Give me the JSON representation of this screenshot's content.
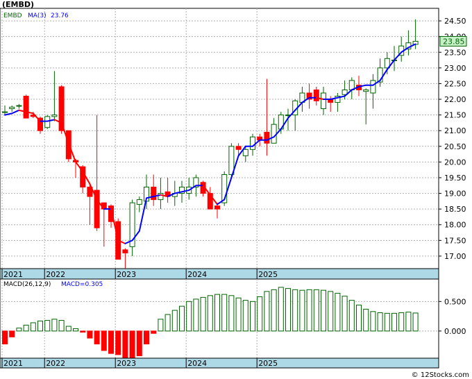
{
  "header": {
    "title": "(EMBD)",
    "watermark": "© 12Stocks.com"
  },
  "colors": {
    "up": "#006400",
    "down": "#ff0000",
    "ma": "#0000ff",
    "ma_down": "#ff0000",
    "axis_band": "#add8e6",
    "grid": "#b0b0b0",
    "last_price_box": "#c8f0c8"
  },
  "chart_data": [
    {
      "type": "candlestick",
      "title": "",
      "legend": {
        "symbol": "EMBD",
        "ma_label": "MA(3)",
        "ma_value": "23.76"
      },
      "last_price_label": "23.85",
      "y_ticks": [
        "17.00",
        "17.50",
        "18.00",
        "18.50",
        "19.00",
        "19.50",
        "20.00",
        "20.50",
        "21.00",
        "21.50",
        "22.00",
        "22.50",
        "23.00",
        "23.50",
        "24.00",
        "24.50"
      ],
      "ylim": [
        16.6,
        24.9
      ],
      "x_year_labels": [
        {
          "label": "2021",
          "index": 0
        },
        {
          "label": "2022",
          "index": 6
        },
        {
          "label": "2023",
          "index": 16
        },
        {
          "label": "2024",
          "index": 26
        },
        {
          "label": "2025",
          "index": 36
        }
      ],
      "ohlc": [
        [
          21.6,
          21.8,
          21.5,
          21.6
        ],
        [
          21.7,
          21.8,
          21.6,
          21.75
        ],
        [
          21.8,
          21.85,
          21.7,
          21.8
        ],
        [
          22.1,
          22.15,
          21.4,
          21.4
        ],
        [
          21.5,
          21.6,
          21.4,
          21.45
        ],
        [
          21.4,
          21.45,
          20.9,
          21.0
        ],
        [
          21.1,
          21.5,
          21.05,
          21.45
        ],
        [
          21.45,
          22.9,
          21.3,
          21.5
        ],
        [
          22.4,
          22.45,
          20.9,
          21.0
        ],
        [
          21.0,
          21.0,
          20.0,
          20.1
        ],
        [
          20.05,
          20.1,
          19.5,
          20.0
        ],
        [
          19.85,
          19.9,
          19.0,
          19.2
        ],
        [
          19.2,
          19.3,
          18.0,
          18.9
        ],
        [
          19.1,
          21.5,
          17.8,
          17.9
        ],
        [
          18.7,
          18.7,
          17.3,
          18.5
        ],
        [
          18.6,
          18.65,
          17.9,
          18.1
        ],
        [
          18.1,
          18.2,
          16.9,
          16.9
        ],
        [
          17.2,
          17.25,
          16.6,
          17.1
        ],
        [
          17.3,
          18.8,
          17.0,
          18.7
        ],
        [
          18.65,
          18.9,
          18.4,
          18.8
        ],
        [
          18.75,
          19.6,
          18.5,
          19.2
        ],
        [
          19.2,
          19.6,
          18.6,
          18.8
        ],
        [
          18.8,
          19.5,
          18.5,
          19.0
        ],
        [
          19.05,
          19.5,
          18.7,
          18.9
        ],
        [
          18.9,
          19.4,
          18.6,
          19.0
        ],
        [
          19.0,
          19.4,
          18.7,
          19.2
        ],
        [
          19.0,
          19.5,
          18.8,
          19.2
        ],
        [
          19.2,
          19.6,
          18.9,
          19.5
        ],
        [
          19.35,
          19.4,
          18.9,
          19.0
        ],
        [
          19.0,
          19.2,
          18.5,
          18.5
        ],
        [
          18.6,
          18.7,
          18.2,
          18.5
        ],
        [
          18.7,
          19.7,
          18.6,
          19.6
        ],
        [
          19.6,
          20.6,
          19.5,
          20.5
        ],
        [
          20.5,
          20.6,
          20.2,
          20.4
        ],
        [
          20.2,
          20.5,
          20.0,
          20.4
        ],
        [
          20.4,
          20.9,
          20.2,
          20.8
        ],
        [
          20.8,
          20.9,
          20.5,
          20.7
        ],
        [
          20.95,
          22.65,
          20.2,
          20.6
        ],
        [
          20.6,
          21.4,
          20.6,
          21.2
        ],
        [
          21.05,
          21.6,
          20.9,
          21.5
        ],
        [
          21.5,
          21.7,
          21.0,
          21.5
        ],
        [
          21.5,
          22.0,
          21.0,
          21.95
        ],
        [
          21.9,
          22.4,
          21.6,
          22.2
        ],
        [
          22.2,
          22.5,
          21.7,
          22.0
        ],
        [
          22.3,
          22.4,
          21.8,
          21.95
        ],
        [
          21.7,
          22.4,
          21.5,
          22.2
        ],
        [
          22.0,
          22.1,
          21.6,
          21.9
        ],
        [
          21.9,
          22.2,
          21.6,
          22.1
        ],
        [
          22.15,
          22.6,
          22.0,
          22.3
        ],
        [
          22.3,
          22.7,
          22.0,
          22.6
        ],
        [
          22.45,
          22.75,
          22.1,
          22.3
        ],
        [
          22.25,
          22.35,
          21.2,
          22.3
        ],
        [
          22.2,
          22.8,
          21.7,
          22.6
        ],
        [
          22.55,
          23.3,
          22.4,
          23.0
        ],
        [
          23.0,
          23.5,
          22.8,
          23.3
        ],
        [
          23.25,
          23.7,
          22.9,
          23.25
        ],
        [
          23.4,
          24.0,
          23.2,
          23.7
        ],
        [
          23.6,
          24.2,
          23.4,
          23.8
        ],
        [
          23.75,
          24.55,
          23.6,
          23.85
        ]
      ],
      "ma3": [
        21.5,
        21.55,
        21.65,
        21.6,
        21.55,
        21.3,
        21.3,
        21.35,
        21.25,
        20.6,
        20.0,
        19.7,
        19.3,
        18.8,
        18.5,
        18.5,
        17.5,
        17.4,
        17.5,
        17.8,
        18.85,
        18.9,
        18.95,
        18.9,
        19.0,
        19.05,
        19.1,
        19.25,
        19.25,
        18.95,
        18.65,
        18.8,
        19.5,
        20.2,
        20.5,
        20.5,
        20.7,
        20.7,
        20.8,
        21.05,
        21.4,
        21.65,
        21.9,
        22.05,
        22.05,
        22.0,
        22.0,
        22.05,
        22.1,
        22.3,
        22.4,
        22.45,
        22.45,
        22.6,
        22.95,
        23.25,
        23.5,
        23.65,
        23.76
      ]
    },
    {
      "type": "bar",
      "title": "",
      "legend": {
        "params": "MACD(26,12,9)",
        "value_label": "MACD=0.305"
      },
      "y_ticks": [
        "0.500",
        "0.000"
      ],
      "ylim": [
        -0.46,
        0.88
      ],
      "x_year_labels": [
        {
          "label": "2021",
          "index": 0
        },
        {
          "label": "2022",
          "index": 6
        },
        {
          "label": "2023",
          "index": 16
        },
        {
          "label": "2024",
          "index": 26
        },
        {
          "label": "2025",
          "index": 36
        }
      ],
      "values": [
        -0.22,
        -0.1,
        0.05,
        0.1,
        0.14,
        0.17,
        0.18,
        0.2,
        0.18,
        0.08,
        0.04,
        -0.02,
        -0.12,
        -0.22,
        -0.33,
        -0.38,
        -0.4,
        -0.45,
        -0.45,
        -0.42,
        -0.22,
        -0.04,
        0.2,
        0.28,
        0.35,
        0.42,
        0.5,
        0.54,
        0.57,
        0.6,
        0.62,
        0.62,
        0.6,
        0.56,
        0.52,
        0.5,
        0.58,
        0.67,
        0.7,
        0.74,
        0.72,
        0.7,
        0.69,
        0.7,
        0.7,
        0.69,
        0.67,
        0.64,
        0.59,
        0.52,
        0.44,
        0.37,
        0.33,
        0.31,
        0.3,
        0.3,
        0.31,
        0.32,
        0.305
      ]
    }
  ]
}
